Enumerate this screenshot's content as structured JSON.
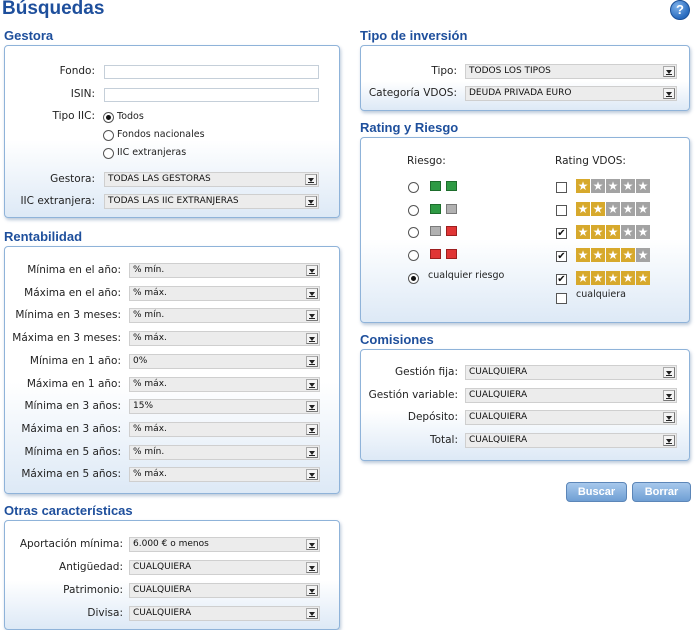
{
  "page": {
    "title": "Búsquedas",
    "help_icon": "?"
  },
  "gestora": {
    "title": "Gestora",
    "fondo_label": "Fondo:",
    "fondo_value": "",
    "isin_label": "ISIN:",
    "isin_value": "",
    "tipo_label": "Tipo IIC:",
    "tipo_options": [
      "Todos",
      "Fondos nacionales",
      "IIC extranjeras"
    ],
    "tipo_selected": 0,
    "gestora_label": "Gestora:",
    "gestora_value": "TODAS LAS GESTORAS",
    "iic_label": "IIC extranjera:",
    "iic_value": "TODAS LAS IIC EXTRANJERAS"
  },
  "rentabilidad": {
    "title": "Rentabilidad",
    "rows": [
      {
        "label": "Mínima en el año:",
        "value": "% mín."
      },
      {
        "label": "Máxima en el año:",
        "value": "% máx."
      },
      {
        "label": "Mínima en 3 meses:",
        "value": "% mín."
      },
      {
        "label": "Máxima en 3 meses:",
        "value": "% máx."
      },
      {
        "label": "Mínima en 1 año:",
        "value": "0%"
      },
      {
        "label": "Máxima en 1 año:",
        "value": "% máx."
      },
      {
        "label": "Mínima en 3 años:",
        "value": "15%"
      },
      {
        "label": "Máxima en 3 años:",
        "value": "% máx."
      },
      {
        "label": "Mínima en 5 años:",
        "value": "% mín."
      },
      {
        "label": "Máxima en 5 años:",
        "value": "% máx."
      }
    ]
  },
  "otras": {
    "title": "Otras características",
    "rows": [
      {
        "label": "Aportación mínima:",
        "value": "6.000 € o menos"
      },
      {
        "label": "Antigüedad:",
        "value": "CUALQUIERA"
      },
      {
        "label": "Patrimonio:",
        "value": "CUALQUIERA"
      },
      {
        "label": "Divisa:",
        "value": "CUALQUIERA"
      }
    ]
  },
  "inversion": {
    "title": "Tipo de inversión",
    "tipo_label": "Tipo:",
    "tipo_value": "TODOS LOS TIPOS",
    "categoria_label": "Categoría VDOS:",
    "categoria_value": "DEUDA PRIVADA EURO"
  },
  "rating": {
    "title": "Rating y Riesgo",
    "riesgo_header": "Riesgo:",
    "rating_header": "Rating VDOS:",
    "riesgo_rows": [
      {
        "colors": [
          "green",
          "green"
        ],
        "selected": false
      },
      {
        "colors": [
          "green",
          "grey"
        ],
        "selected": false
      },
      {
        "colors": [
          "grey",
          "red"
        ],
        "selected": false
      },
      {
        "colors": [
          "red",
          "red"
        ],
        "selected": false
      }
    ],
    "riesgo_any_label": "cualquier riesgo",
    "riesgo_any_selected": true,
    "rating_rows": [
      {
        "stars": 1,
        "checked": false
      },
      {
        "stars": 2,
        "checked": false
      },
      {
        "stars": 3,
        "checked": true
      },
      {
        "stars": 4,
        "checked": true
      },
      {
        "stars": 5,
        "checked": true
      }
    ],
    "rating_any_label": "cualquiera",
    "rating_any_checked": false,
    "colors": {
      "gold": "#d7a92c",
      "grey": "#a3a3a3",
      "green": "#2e9a44",
      "red": "#e03535"
    }
  },
  "comisiones": {
    "title": "Comisiones",
    "rows": [
      {
        "label": "Gestión fija:",
        "value": "CUALQUIERA"
      },
      {
        "label": "Gestión variable:",
        "value": "CUALQUIERA"
      },
      {
        "label": "Depósito:",
        "value": "CUALQUIERA"
      },
      {
        "label": "Total:",
        "value": "CUALQUIERA"
      }
    ]
  },
  "actions": {
    "buscar": "Buscar",
    "borrar": "Borrar"
  }
}
